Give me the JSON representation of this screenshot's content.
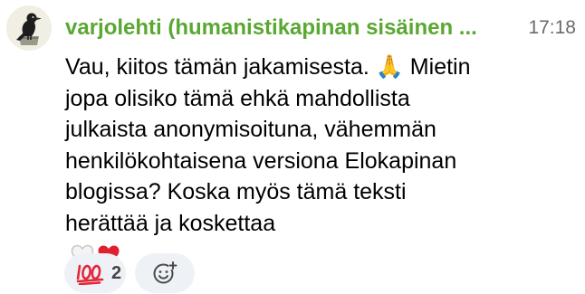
{
  "message": {
    "author": "varjolehti (humanistikapinan sisäinen ...",
    "time": "17:18",
    "lines": [
      "Vau, kiitos tämän jakamisesta. 🙏 Mietin",
      "jopa olisiko tämä ehkä mahdollista",
      "julkaista anonymisoituna, vähemmän",
      "henkilökohtaisena versiona Elokapinan",
      "blogissa? Koska myös tämä teksti",
      "herättää ja koskettaa"
    ],
    "trailing_emoji": [
      "white-heart-icon",
      "red-heart-icon"
    ]
  },
  "reactions": [
    {
      "icon": "hundred-points-icon",
      "count": "2"
    },
    {
      "icon": "add-reaction-icon"
    }
  ],
  "colors": {
    "author": "#5aa831",
    "time": "#6b6b6b",
    "chip_background": "#eef2f6",
    "red_heart": "#e0202e"
  }
}
